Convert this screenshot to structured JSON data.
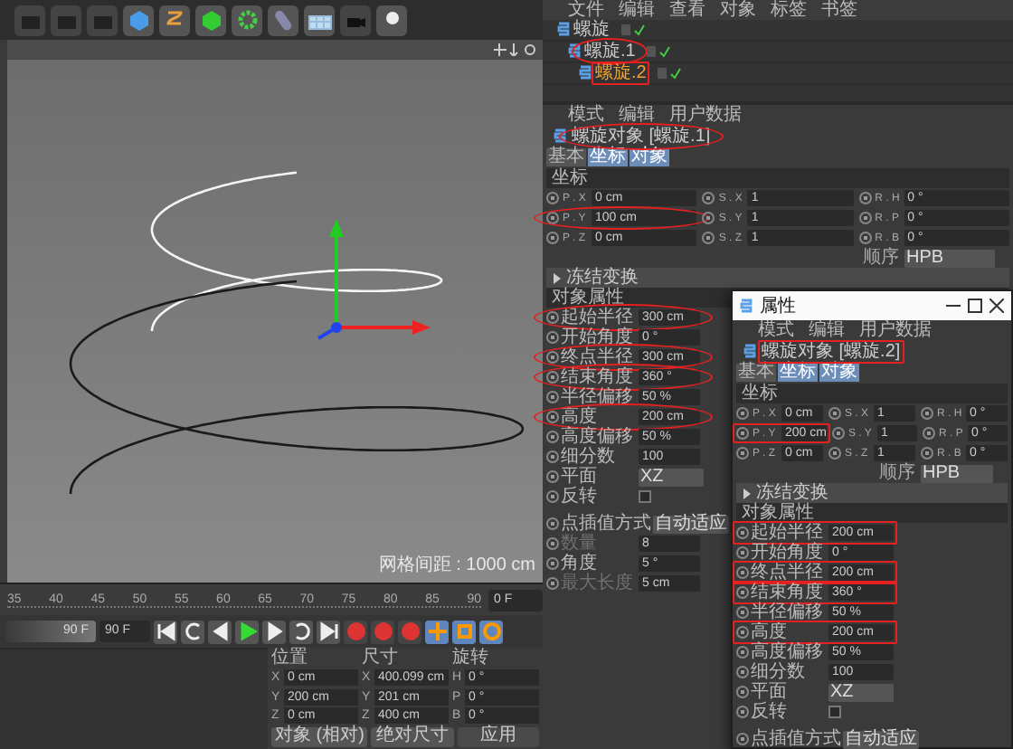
{
  "viewport": {
    "grid_label": "网格间距 : 1000 cm"
  },
  "timeline": {
    "ruler": [
      "35",
      "40",
      "45",
      "50",
      "55",
      "60",
      "65",
      "70",
      "75",
      "80",
      "85",
      "90"
    ],
    "current_frame": "0 F"
  },
  "transport": {
    "range_label": "90 F",
    "level": 1,
    "end_frame": "90 F"
  },
  "coord_manager": {
    "headers": [
      "位置",
      "尺寸",
      "旋转"
    ],
    "rows": [
      {
        "cells": [
          {
            "axis": "X",
            "value": "0 cm"
          },
          {
            "axis": "X",
            "value": "400.099 cm"
          },
          {
            "axis": "H",
            "value": "0 °"
          }
        ]
      },
      {
        "cells": [
          {
            "axis": "Y",
            "value": "200 cm"
          },
          {
            "axis": "Y",
            "value": "201 cm"
          },
          {
            "axis": "P",
            "value": "0 °"
          }
        ]
      },
      {
        "cells": [
          {
            "axis": "Z",
            "value": "0 cm"
          },
          {
            "axis": "Z",
            "value": "400 cm"
          },
          {
            "axis": "B",
            "value": "0 °"
          }
        ]
      }
    ],
    "buttons": [
      {
        "label": "对象 (相对)",
        "kind": "dropdown"
      },
      {
        "label": "绝对尺寸",
        "kind": "dropdown"
      },
      {
        "label": "应用",
        "kind": "button"
      }
    ]
  },
  "object_manager": {
    "menu": [
      "文件",
      "编辑",
      "查看",
      "对象",
      "标签",
      "书签"
    ],
    "objects": [
      {
        "name": "螺旋",
        "selected": false,
        "children": [
          {
            "name": "螺旋.1",
            "selected": false,
            "circled": true,
            "children": [
              {
                "name": "螺旋.2",
                "selected": true,
                "boxed": true
              }
            ]
          }
        ]
      }
    ]
  },
  "attributes": {
    "menu": [
      "模式",
      "编辑",
      "用户数据"
    ],
    "object": {
      "name": "螺旋对象 [螺旋.1]",
      "circled": true
    },
    "tabs": [
      {
        "label": "基本",
        "selected": false
      },
      {
        "label": "坐标",
        "selected": true
      },
      {
        "label": "对象",
        "selected": true
      }
    ],
    "coord_title": "坐标",
    "coords": [
      {
        "cells": [
          {
            "label": "P . X",
            "value": "0 cm"
          },
          {
            "label": "S . X",
            "value": "1"
          },
          {
            "label": "R . H",
            "value": "0 °"
          }
        ]
      },
      {
        "cells": [
          {
            "label": "P . Y",
            "value": "100 cm",
            "circled": true
          },
          {
            "label": "S . Y",
            "value": "1"
          },
          {
            "label": "R . P",
            "value": "0 °"
          }
        ]
      },
      {
        "cells": [
          {
            "label": "P . Z",
            "value": "0 cm"
          },
          {
            "label": "S . Z",
            "value": "1"
          },
          {
            "label": "R . B",
            "value": "0 °"
          }
        ]
      }
    ],
    "order": {
      "label": "顺序",
      "value": "HPB"
    },
    "freeze": "冻结变换",
    "props_title": "对象属性",
    "props": [
      {
        "label": "起始半径",
        "value": "300 cm",
        "kind": "field",
        "circled": true
      },
      {
        "label": "开始角度",
        "value": "0 °",
        "kind": "field"
      },
      {
        "label": "终点半径",
        "value": "300 cm",
        "kind": "field",
        "circled": true
      },
      {
        "label": "结束角度",
        "value": "360 °",
        "kind": "field",
        "circled": true
      },
      {
        "label": "半径偏移",
        "value": "50 %",
        "kind": "field"
      },
      {
        "label": "高度",
        "value": "200 cm",
        "kind": "field",
        "circled": true
      },
      {
        "label": "高度偏移",
        "value": "50 %",
        "kind": "field"
      },
      {
        "label": "细分数",
        "value": "100",
        "kind": "field"
      },
      {
        "label": "平面",
        "value": "XZ",
        "kind": "dropdown"
      },
      {
        "label": "反转",
        "kind": "checkbox",
        "checked": false
      }
    ],
    "interp": [
      {
        "label": "点插值方式",
        "value": "自动适应",
        "kind": "dropdown",
        "disabled": false
      },
      {
        "label": "数量",
        "value": "8",
        "kind": "field",
        "disabled": true
      },
      {
        "label": "角度",
        "value": "5 °",
        "kind": "field",
        "disabled": false
      },
      {
        "label": "最大长度",
        "value": "5 cm",
        "kind": "field",
        "disabled": true
      }
    ]
  },
  "window": {
    "title": "属性",
    "menu": [
      "模式",
      "编辑",
      "用户数据"
    ],
    "object": {
      "name": "螺旋对象 [螺旋.2]",
      "boxed": true
    },
    "tabs": [
      {
        "label": "基本",
        "selected": false
      },
      {
        "label": "坐标",
        "selected": true
      },
      {
        "label": "对象",
        "selected": true
      }
    ],
    "coord_title": "坐标",
    "coords": [
      {
        "cells": [
          {
            "label": "P . X",
            "value": "0 cm"
          },
          {
            "label": "S . X",
            "value": "1"
          },
          {
            "label": "R . H",
            "value": "0 °"
          }
        ]
      },
      {
        "cells": [
          {
            "label": "P . Y",
            "value": "200 cm",
            "boxed": true
          },
          {
            "label": "S . Y",
            "value": "1"
          },
          {
            "label": "R . P",
            "value": "0 °"
          }
        ]
      },
      {
        "cells": [
          {
            "label": "P . Z",
            "value": "0 cm"
          },
          {
            "label": "S . Z",
            "value": "1"
          },
          {
            "label": "R . B",
            "value": "0 °"
          }
        ]
      }
    ],
    "order": {
      "label": "顺序",
      "value": "HPB"
    },
    "freeze": "冻结变换",
    "props_title": "对象属性",
    "props": [
      {
        "label": "起始半径",
        "value": "200 cm",
        "kind": "field",
        "boxed": true
      },
      {
        "label": "开始角度",
        "value": "0 °",
        "kind": "field"
      },
      {
        "label": "终点半径",
        "value": "200 cm",
        "kind": "field",
        "boxed": true
      },
      {
        "label": "结束角度",
        "value": "360 °",
        "kind": "field",
        "boxed": true
      },
      {
        "label": "半径偏移",
        "value": "50 %",
        "kind": "field"
      },
      {
        "label": "高度",
        "value": "200 cm",
        "kind": "field",
        "boxed": true
      },
      {
        "label": "高度偏移",
        "value": "50 %",
        "kind": "field"
      },
      {
        "label": "细分数",
        "value": "100",
        "kind": "field"
      },
      {
        "label": "平面",
        "value": "XZ",
        "kind": "dropdown"
      },
      {
        "label": "反转",
        "kind": "checkbox",
        "checked": false
      }
    ],
    "interp": [
      {
        "label": "点插值方式",
        "value": "自动适应",
        "kind": "dropdown",
        "disabled": false
      }
    ]
  }
}
